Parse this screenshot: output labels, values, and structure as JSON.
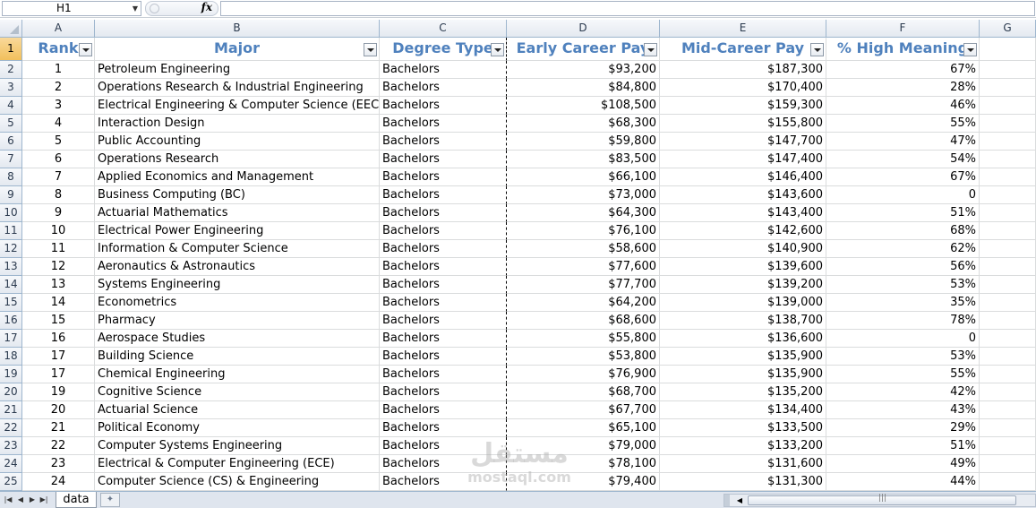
{
  "formula_bar": {
    "name_box": "H1",
    "fx_label": "fx",
    "formula": ""
  },
  "columns": [
    "A",
    "B",
    "C",
    "D",
    "E",
    "F",
    "G"
  ],
  "header_row": {
    "row_num": "1",
    "cells": [
      "Rank",
      "Major",
      "Degree Type",
      "Early Career Pay",
      "Mid-Career Pay",
      "% High Meaning"
    ]
  },
  "rows": [
    {
      "n": "2",
      "rank": "1",
      "major": "Petroleum Engineering",
      "degree": "Bachelors",
      "early": "$93,200",
      "mid": "$187,300",
      "meaning": "67%"
    },
    {
      "n": "3",
      "rank": "2",
      "major": "Operations Research & Industrial Engineering",
      "degree": "Bachelors",
      "early": "$84,800",
      "mid": "$170,400",
      "meaning": "28%"
    },
    {
      "n": "4",
      "rank": "3",
      "major": "Electrical Engineering & Computer Science (EECS)",
      "degree": "Bachelors",
      "early": "$108,500",
      "mid": "$159,300",
      "meaning": "46%"
    },
    {
      "n": "5",
      "rank": "4",
      "major": "Interaction Design",
      "degree": "Bachelors",
      "early": "$68,300",
      "mid": "$155,800",
      "meaning": "55%"
    },
    {
      "n": "6",
      "rank": "5",
      "major": "Public Accounting",
      "degree": "Bachelors",
      "early": "$59,800",
      "mid": "$147,700",
      "meaning": "47%"
    },
    {
      "n": "7",
      "rank": "6",
      "major": "Operations Research",
      "degree": "Bachelors",
      "early": "$83,500",
      "mid": "$147,400",
      "meaning": "54%"
    },
    {
      "n": "8",
      "rank": "7",
      "major": "Applied Economics and Management",
      "degree": "Bachelors",
      "early": "$66,100",
      "mid": "$146,400",
      "meaning": "67%"
    },
    {
      "n": "9",
      "rank": "8",
      "major": "Business Computing (BC)",
      "degree": "Bachelors",
      "early": "$73,000",
      "mid": "$143,600",
      "meaning": "0"
    },
    {
      "n": "10",
      "rank": "9",
      "major": "Actuarial Mathematics",
      "degree": "Bachelors",
      "early": "$64,300",
      "mid": "$143,400",
      "meaning": "51%"
    },
    {
      "n": "11",
      "rank": "10",
      "major": "Electrical Power Engineering",
      "degree": "Bachelors",
      "early": "$76,100",
      "mid": "$142,600",
      "meaning": "68%"
    },
    {
      "n": "12",
      "rank": "11",
      "major": "Information & Computer Science",
      "degree": "Bachelors",
      "early": "$58,600",
      "mid": "$140,900",
      "meaning": "62%"
    },
    {
      "n": "13",
      "rank": "12",
      "major": "Aeronautics & Astronautics",
      "degree": "Bachelors",
      "early": "$77,600",
      "mid": "$139,600",
      "meaning": "56%"
    },
    {
      "n": "14",
      "rank": "13",
      "major": "Systems Engineering",
      "degree": "Bachelors",
      "early": "$77,700",
      "mid": "$139,200",
      "meaning": "53%"
    },
    {
      "n": "15",
      "rank": "14",
      "major": "Econometrics",
      "degree": "Bachelors",
      "early": "$64,200",
      "mid": "$139,000",
      "meaning": "35%"
    },
    {
      "n": "16",
      "rank": "15",
      "major": "Pharmacy",
      "degree": "Bachelors",
      "early": "$68,600",
      "mid": "$138,700",
      "meaning": "78%"
    },
    {
      "n": "17",
      "rank": "16",
      "major": "Aerospace Studies",
      "degree": "Bachelors",
      "early": "$55,800",
      "mid": "$136,600",
      "meaning": "0"
    },
    {
      "n": "18",
      "rank": "17",
      "major": "Building Science",
      "degree": "Bachelors",
      "early": "$53,800",
      "mid": "$135,900",
      "meaning": "53%"
    },
    {
      "n": "19",
      "rank": "17",
      "major": "Chemical Engineering",
      "degree": "Bachelors",
      "early": "$76,900",
      "mid": "$135,900",
      "meaning": "55%"
    },
    {
      "n": "20",
      "rank": "19",
      "major": "Cognitive Science",
      "degree": "Bachelors",
      "early": "$68,700",
      "mid": "$135,200",
      "meaning": "42%"
    },
    {
      "n": "21",
      "rank": "20",
      "major": "Actuarial Science",
      "degree": "Bachelors",
      "early": "$67,700",
      "mid": "$134,400",
      "meaning": "43%"
    },
    {
      "n": "22",
      "rank": "21",
      "major": "Political Economy",
      "degree": "Bachelors",
      "early": "$65,100",
      "mid": "$133,500",
      "meaning": "29%"
    },
    {
      "n": "23",
      "rank": "22",
      "major": "Computer Systems Engineering",
      "degree": "Bachelors",
      "early": "$79,000",
      "mid": "$133,200",
      "meaning": "51%"
    },
    {
      "n": "24",
      "rank": "23",
      "major": "Electrical & Computer Engineering (ECE)",
      "degree": "Bachelors",
      "early": "$78,100",
      "mid": "$131,600",
      "meaning": "49%"
    },
    {
      "n": "25",
      "rank": "24",
      "major": "Computer Science (CS) & Engineering",
      "degree": "Bachelors",
      "early": "$79,400",
      "mid": "$131,300",
      "meaning": "44%"
    }
  ],
  "sheet_tabs": {
    "active": "data"
  },
  "watermark": {
    "text": "مستقل",
    "sub": "mostaql.com"
  },
  "colors": {
    "header_text": "#4f81bd",
    "selected_row_header": "#f1c05c"
  }
}
